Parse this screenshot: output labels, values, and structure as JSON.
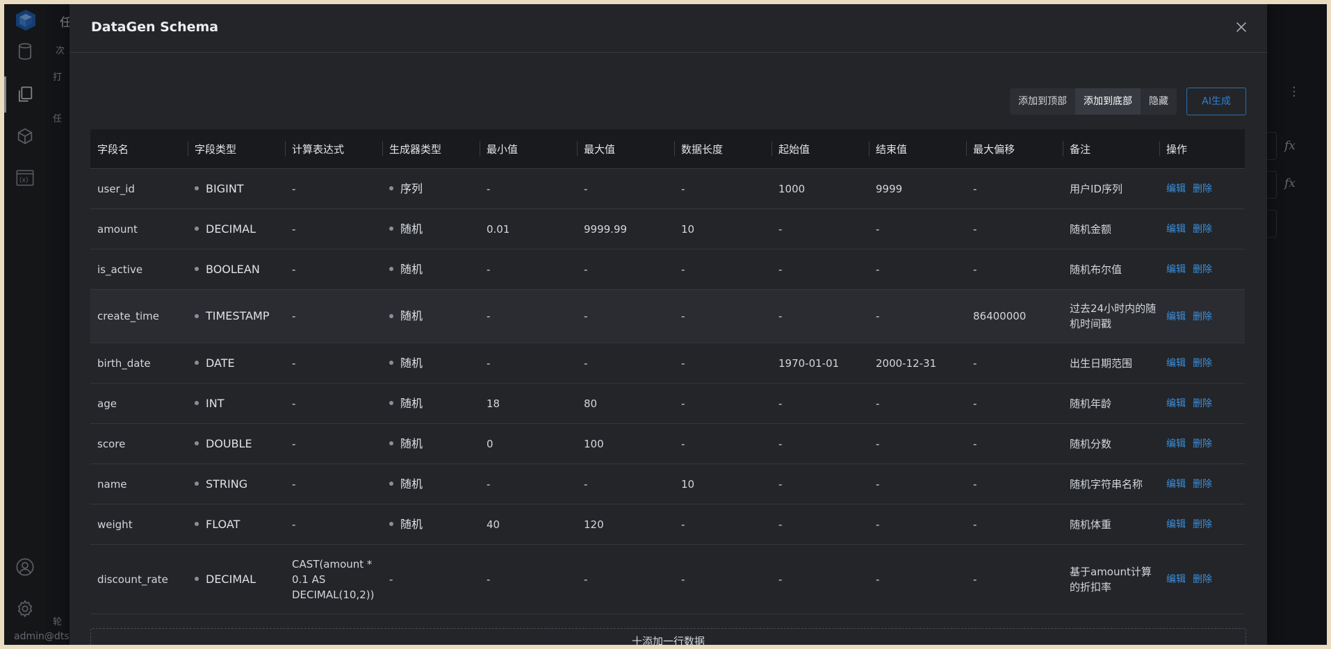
{
  "background": {
    "side_title": "任",
    "side_items": [
      "次",
      "打",
      "任",
      "轮"
    ],
    "status_user": "admin@dts"
  },
  "modal": {
    "title": "DataGen Schema",
    "toolbar": {
      "add_top": "添加到顶部",
      "add_bottom": "添加到底部",
      "hide": "隐藏",
      "ai_generate": "AI生成"
    },
    "columns": [
      "字段名",
      "字段类型",
      "计算表达式",
      "生成器类型",
      "最小值",
      "最大值",
      "数据长度",
      "起始值",
      "结束值",
      "最大偏移",
      "备注",
      "操作"
    ],
    "actions": {
      "edit": "编辑",
      "delete": "删除"
    },
    "rows": [
      {
        "name": "user_id",
        "type": "BIGINT",
        "expr": "-",
        "gen": "序列",
        "min": "-",
        "max": "-",
        "len": "-",
        "start": "1000",
        "end": "9999",
        "offset": "-",
        "note": "用户ID序列"
      },
      {
        "name": "amount",
        "type": "DECIMAL",
        "expr": "-",
        "gen": "随机",
        "min": "0.01",
        "max": "9999.99",
        "len": "10",
        "start": "-",
        "end": "-",
        "offset": "-",
        "note": "随机金额"
      },
      {
        "name": "is_active",
        "type": "BOOLEAN",
        "expr": "-",
        "gen": "随机",
        "min": "-",
        "max": "-",
        "len": "-",
        "start": "-",
        "end": "-",
        "offset": "-",
        "note": "随机布尔值"
      },
      {
        "name": "create_time",
        "type": "TIMESTAMP",
        "expr": "-",
        "gen": "随机",
        "min": "-",
        "max": "-",
        "len": "-",
        "start": "-",
        "end": "-",
        "offset": "86400000",
        "note": "过去24小时内的随机时间戳"
      },
      {
        "name": "birth_date",
        "type": "DATE",
        "expr": "-",
        "gen": "随机",
        "min": "-",
        "max": "-",
        "len": "-",
        "start": "1970-01-01",
        "end": "2000-12-31",
        "offset": "-",
        "note": "出生日期范围"
      },
      {
        "name": "age",
        "type": "INT",
        "expr": "-",
        "gen": "随机",
        "min": "18",
        "max": "80",
        "len": "-",
        "start": "-",
        "end": "-",
        "offset": "-",
        "note": "随机年龄"
      },
      {
        "name": "score",
        "type": "DOUBLE",
        "expr": "-",
        "gen": "随机",
        "min": "0",
        "max": "100",
        "len": "-",
        "start": "-",
        "end": "-",
        "offset": "-",
        "note": "随机分数"
      },
      {
        "name": "name",
        "type": "STRING",
        "expr": "-",
        "gen": "随机",
        "min": "-",
        "max": "-",
        "len": "10",
        "start": "-",
        "end": "-",
        "offset": "-",
        "note": "随机字符串名称"
      },
      {
        "name": "weight",
        "type": "FLOAT",
        "expr": "-",
        "gen": "随机",
        "min": "40",
        "max": "120",
        "len": "-",
        "start": "-",
        "end": "-",
        "offset": "-",
        "note": "随机体重"
      },
      {
        "name": "discount_rate",
        "type": "DECIMAL",
        "expr": "CAST(amount * 0.1 AS DECIMAL(10,2))",
        "gen": "-",
        "min": "-",
        "max": "-",
        "len": "-",
        "start": "-",
        "end": "-",
        "offset": "-",
        "note": "基于amount计算的折扣率"
      }
    ],
    "add_row_label": "十添加一行数据"
  }
}
